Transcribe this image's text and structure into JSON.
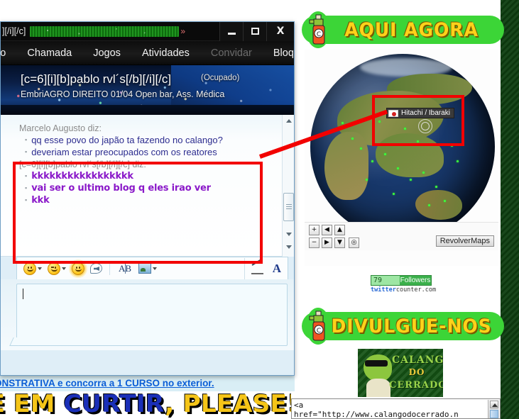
{
  "msn_window": {
    "titlebar": {
      "visible_title_prefix": "][/i][/c]",
      "redacted_label": "redacted-green-highlight",
      "caret": "»",
      "minimize_label": "Minimizar",
      "maximize_label": "Maximizar",
      "close_label": "X"
    },
    "menu": {
      "items": [
        {
          "label": "leo",
          "disabled": false
        },
        {
          "label": "Chamada",
          "disabled": false
        },
        {
          "label": "Jogos",
          "disabled": false
        },
        {
          "label": "Atividades",
          "disabled": false
        },
        {
          "label": "Convidar",
          "disabled": true
        },
        {
          "label": "Bloquear",
          "disabled": false
        }
      ],
      "overflow_icon": "sheet-icon",
      "overflow_caret": "▾"
    },
    "contact": {
      "display_name": "[c=6][i][b]pablo rvl´s[/b][/i][/c]",
      "status": "(Ocupado)",
      "personal_message": "EmbriAGRO DIREITO 01/04 Open bar, Ass. Médica"
    },
    "conversation": {
      "blocks": [
        {
          "sender": "Marcelo Augusto diz:",
          "style": "blue",
          "lines": [
            "qq esse povo do japão ta fazendo no calango?",
            "deveriam estar preocupados com os reatores"
          ]
        },
        {
          "sender": "[c=6][i][b]pablo rvl´s[/b][/i][/c] diz:",
          "style": "purple",
          "lines": [
            "kkkkkkkkkkkkkkkkk",
            "vai ser o ultimo blog q eles irao ver",
            "kkk"
          ]
        }
      ]
    },
    "input": {
      "value": "",
      "placeholder": ""
    },
    "toolbar": {
      "emoticon_label": "Emoticon",
      "wink_label": "Piscadela",
      "nudge_label": "Chamar atenção",
      "voice_clip_label": "Clipe de voz",
      "text_format_label": "AB",
      "photo_label": "Foto",
      "handwriting_label": "Escrita à mão",
      "font_label": "A"
    }
  },
  "annotations": {
    "rect_chat_color": "#f20000",
    "rect_globe_color": "#f20000",
    "connector_color": "#f20000"
  },
  "page": {
    "banner_top": {
      "text": "AQUI AGORA",
      "bg_color": "#3cd537",
      "text_color": "#ffd21a"
    },
    "banner_bottom": {
      "text": "DIVULGUE-NOS",
      "bg_color": "#3cd537",
      "text_color": "#ffd21a"
    },
    "globe_widget": {
      "marker_label": "Hitachi / Ibaraki",
      "marker_flag": "japan-flag",
      "brand_badge": "RevolverMaps",
      "controls": [
        {
          "name": "zoom-in",
          "glyph": "+"
        },
        {
          "name": "pan-left",
          "glyph": "◀"
        },
        {
          "name": "pan-up",
          "glyph": "▲"
        },
        {
          "name": "zoom-out",
          "glyph": "−"
        },
        {
          "name": "pan-right",
          "glyph": "▶"
        },
        {
          "name": "pan-down",
          "glyph": "▼"
        },
        {
          "name": "reset-view",
          "glyph": "◎"
        }
      ]
    },
    "twitter_counter": {
      "count": "79",
      "label": "Followers",
      "domain_prefix": "twitter",
      "domain_suffix": "counter.com"
    },
    "calango_image": {
      "line1": "CALANGO",
      "line2": "DO",
      "line3": "CERRADO"
    },
    "code_box": {
      "line1": "<a",
      "line2": "href=\"http://www.calangodocerrado.n"
    },
    "promo_link": "ONSTRATIVA e concorra a 1 CURSO no exterior.",
    "bottom_banner": {
      "part1": "E EM ",
      "part2": "CURTIR",
      "part3": ", PLEASE!!!"
    }
  }
}
